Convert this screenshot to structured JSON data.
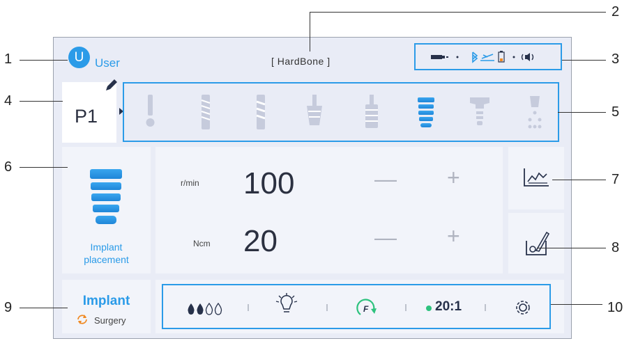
{
  "callouts": [
    "1",
    "2",
    "3",
    "4",
    "5",
    "6",
    "7",
    "8",
    "9",
    "10"
  ],
  "user": {
    "avatar_letter": "U",
    "name": "User"
  },
  "bone_type": "[ HardBone ]",
  "program": {
    "label": "P1"
  },
  "step_icons": [
    "drill-pointer-icon",
    "drill-1-icon",
    "drill-2-icon",
    "countersink-icon",
    "tap-icon",
    "implant-icon",
    "abutment-icon",
    "irrigation-icon"
  ],
  "mode": {
    "label_line1": "Implant",
    "label_line2": "placement"
  },
  "speed": {
    "unit": "r/min",
    "value": "100"
  },
  "torque": {
    "unit": "Ncm",
    "value": "20"
  },
  "bottom": {
    "title": "Implant",
    "subtitle": "Surgery",
    "ratio": "20:1",
    "direction": "F"
  },
  "colors": {
    "accent": "#2b9be8",
    "orange": "#f08a24",
    "green": "#2ec27e"
  }
}
